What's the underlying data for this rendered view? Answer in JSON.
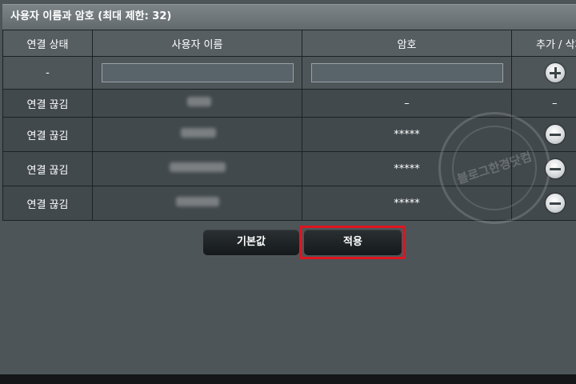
{
  "panel": {
    "title": "사용자 이름과 암호 (최대 제한: 32)"
  },
  "table": {
    "headers": [
      "연결 상태",
      "사용자 이름",
      "암호",
      "추가 / 삭제"
    ],
    "input_row": {
      "status": "-"
    },
    "rows": [
      {
        "status": "연결 끊김",
        "password": "–",
        "action": "–"
      },
      {
        "status": "연결 끊김",
        "password": "*****"
      },
      {
        "status": "연결 끊김",
        "password": "*****"
      },
      {
        "status": "연결 끊김",
        "password": "*****"
      }
    ]
  },
  "icons": {
    "add": "plus-circle-icon",
    "remove": "minus-circle-icon"
  },
  "watermark": {
    "text": "블로그한경닷컴"
  },
  "buttons": {
    "default_label": "기본값",
    "apply_label": "적용"
  },
  "colors": {
    "highlight": "#e0141e",
    "background": "#4d5559"
  }
}
